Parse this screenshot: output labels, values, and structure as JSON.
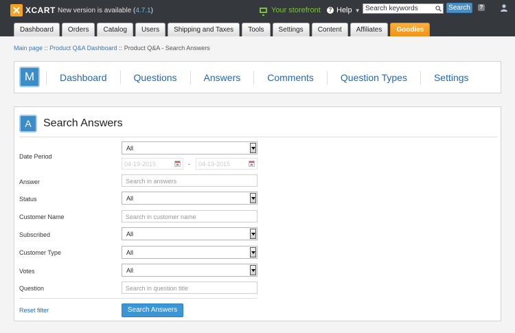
{
  "topbar": {
    "logo_text": "XCART",
    "new_version_prefix": "New version is available (",
    "new_version": "4.7.1",
    "new_version_suffix": ")",
    "storefront": "Your storefront",
    "help": "Help",
    "search_placeholder": "Search keywords",
    "search_button": "Search",
    "question": "?"
  },
  "tabs": [
    "Dashboard",
    "Orders",
    "Catalog",
    "Users",
    "Shipping and Taxes",
    "Tools",
    "Settings",
    "Content",
    "Affiliates",
    "Goodies"
  ],
  "active_tab": "Goodies",
  "breadcrumb": {
    "main": "Main page",
    "dashboard": "Product Q&A Dashboard",
    "current": "Product Q&A - Search Answers",
    "sep": "::"
  },
  "module_nav": {
    "badge": "M",
    "links": [
      "Dashboard",
      "Questions",
      "Answers",
      "Comments",
      "Question Types",
      "Settings"
    ]
  },
  "panel": {
    "badge": "A",
    "title": "Search Answers",
    "fields": {
      "date_period": {
        "label": "Date Period",
        "value": "All",
        "from": "04-19-2015",
        "to": "04-19-2015",
        "dash": "-"
      },
      "answer": {
        "label": "Answer",
        "placeholder": "Search in answers"
      },
      "status": {
        "label": "Status",
        "value": "All"
      },
      "customer_name": {
        "label": "Customer Name",
        "placeholder": "Search in customer name"
      },
      "subscribed": {
        "label": "Subscribed",
        "value": "All"
      },
      "customer_type": {
        "label": "Customer Type",
        "value": "All"
      },
      "votes": {
        "label": "Votes",
        "value": "All"
      },
      "question": {
        "label": "Question",
        "placeholder": "Search in question title"
      }
    },
    "reset": "Reset filter",
    "submit": "Search Answers"
  },
  "colors": {
    "accent": "#3e95d3",
    "active_tab": "#f3a321",
    "storefront": "#7cc242",
    "topbar": "#35393e"
  }
}
